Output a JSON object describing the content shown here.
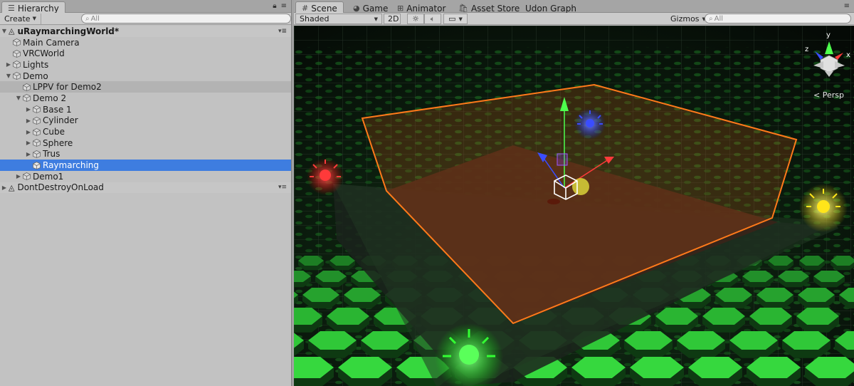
{
  "hierarchy": {
    "tab_label": "Hierarchy",
    "create_label": "Create",
    "search_placeholder": "All",
    "scene_name": "uRaymarchingWorld*",
    "items": [
      {
        "label": "Main Camera",
        "depth": 1,
        "arrow": ""
      },
      {
        "label": "VRCWorld",
        "depth": 1,
        "arrow": ""
      },
      {
        "label": "Lights",
        "depth": 1,
        "arrow": "collapsed"
      },
      {
        "label": "Demo",
        "depth": 1,
        "arrow": "expanded"
      },
      {
        "label": "LPPV for Demo2",
        "depth": 2,
        "arrow": ""
      },
      {
        "label": "Demo 2",
        "depth": 2,
        "arrow": "expanded"
      },
      {
        "label": "Base 1",
        "depth": 3,
        "arrow": "collapsed"
      },
      {
        "label": "Cylinder",
        "depth": 3,
        "arrow": "collapsed"
      },
      {
        "label": "Cube",
        "depth": 3,
        "arrow": "collapsed"
      },
      {
        "label": "Sphere",
        "depth": 3,
        "arrow": "collapsed"
      },
      {
        "label": "Trus",
        "depth": 3,
        "arrow": "collapsed"
      },
      {
        "label": "Raymarching",
        "depth": 3,
        "arrow": "",
        "selected": true
      },
      {
        "label": "Demo1",
        "depth": 2,
        "arrow": "collapsed"
      }
    ],
    "dont_destroy_label": "DontDestroyOnLoad"
  },
  "scene_tabs": [
    {
      "label": "Scene",
      "icon": "grid-icon",
      "active": true
    },
    {
      "label": "Game",
      "icon": "pacman-icon",
      "active": false
    },
    {
      "label": "Animator",
      "icon": "animator-icon",
      "active": false
    },
    {
      "label": "Asset Store",
      "icon": "store-icon",
      "active": false
    },
    {
      "label": "Udon Graph",
      "icon": "",
      "active": false
    }
  ],
  "scene_toolbar": {
    "shading_mode": "Shaded",
    "mode_2d": "2D",
    "gizmos_label": "Gizmos",
    "search_placeholder": "All"
  },
  "viewport": {
    "projection_label": "< Persp",
    "gizmo_axes": {
      "x": "x",
      "y": "y",
      "z": "z"
    }
  },
  "colors": {
    "selection": "#3e7de0",
    "bounds_outline": "#ff7a1a",
    "light_red": "#ff2a2a",
    "light_green": "#33ff33",
    "light_blue": "#3a4dff",
    "light_yellow": "#ffe51a",
    "hex_tile": "#1f9a28"
  }
}
